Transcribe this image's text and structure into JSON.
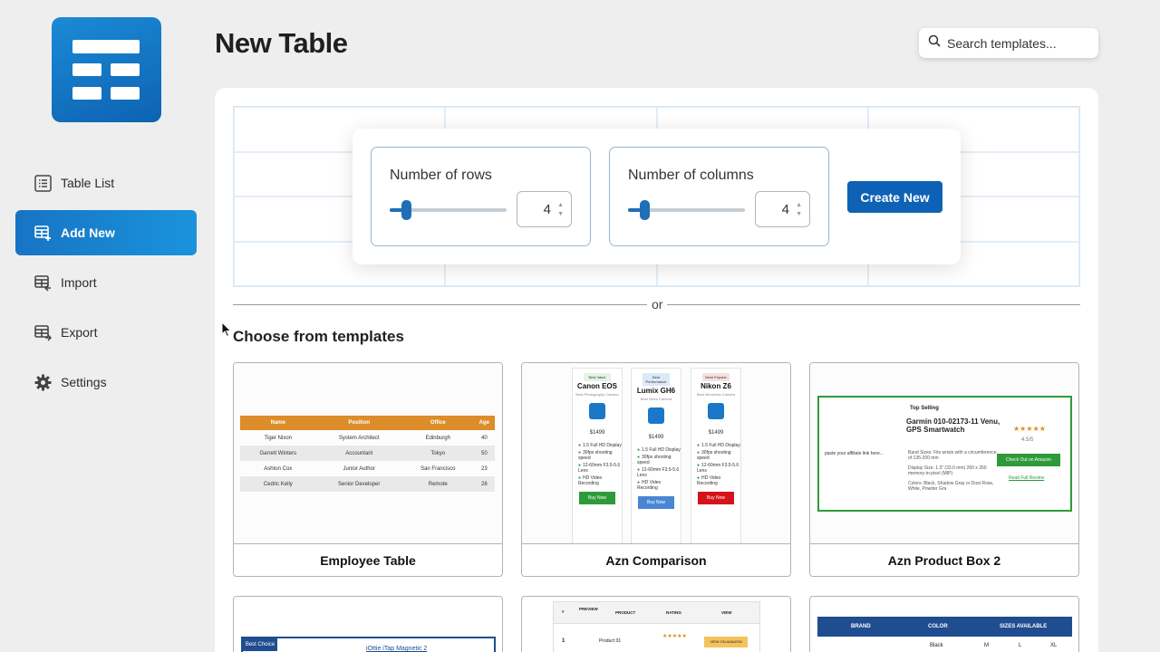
{
  "sidebar": {
    "items": [
      {
        "label": "Table List",
        "icon": "list-icon"
      },
      {
        "label": "Add New",
        "icon": "table-add-icon",
        "active": true
      },
      {
        "label": "Import",
        "icon": "table-import-icon"
      },
      {
        "label": "Export",
        "icon": "table-export-icon"
      },
      {
        "label": "Settings",
        "icon": "gear-icon"
      }
    ]
  },
  "header": {
    "title": "New Table"
  },
  "search": {
    "placeholder": "Search templates..."
  },
  "creator": {
    "rows_label": "Number of rows",
    "rows_value": "4",
    "cols_label": "Number of columns",
    "cols_value": "4",
    "create_label": "Create New"
  },
  "divider_text": "or",
  "templates_title": "Choose from templates",
  "templates": [
    {
      "name": "Employee Table",
      "preview": {
        "headers": [
          "Name",
          "Position",
          "Office",
          "Age"
        ],
        "rows": [
          [
            "Tiger Nixon",
            "System Architect",
            "Edinburgh",
            "40"
          ],
          [
            "Garrett Winters",
            "Accountant",
            "Tokyo",
            "50"
          ],
          [
            "Ashton Cox",
            "Junior Author",
            "San Francisco",
            "23"
          ],
          [
            "Cedric Kelly",
            "Senior Developer",
            "Remote",
            "28"
          ]
        ]
      }
    },
    {
      "name": "Azn Comparison",
      "preview": {
        "products": [
          {
            "badge": "Best Value",
            "name": "Canon EOS",
            "sub": "Best Photography Camera",
            "price": "$1499",
            "features": [
              "1.5 Full HD Display",
              "30fps shooting speed",
              "12-60mm F3.5-5.6 Lens",
              "HD Video Recording"
            ],
            "buy": "Buy Now",
            "buy_color": "#2f9a3a",
            "badge_bg": "#e4f3e4"
          },
          {
            "badge": "Best Performance",
            "name": "Lumix GH6",
            "sub": "Best Video Camera",
            "price": "$1499",
            "features": [
              "1.5 Full HD Display",
              "30fps shooting speed",
              "12-60mm F3.5-5.6 Lens",
              "HD Video Recording"
            ],
            "buy": "Buy Now",
            "buy_color": "#4a86d4",
            "badge_bg": "#dce9f7"
          },
          {
            "badge": "Most Popular",
            "name": "Nikon Z6",
            "sub": "Best Mirrorless Camera",
            "price": "$1499",
            "features": [
              "1.5 Full HD Display",
              "30fps shooting speed",
              "12-60mm F3.5-5.6 Lens",
              "HD Video Recording"
            ],
            "buy": "Buy Now",
            "buy_color": "#d4131b",
            "badge_bg": "#f7e0e0"
          }
        ]
      }
    },
    {
      "name": "Azn Product Box 2",
      "preview": {
        "tag": "Top Selling",
        "title": "Garmin 010-02173-11 Venu, GPS Smartwatch",
        "rating": "4.5/5",
        "left_text": "paste your affiliate link here...",
        "features": [
          "Band Sizes: Fits wrists with a circumference of 135-200 mm",
          "Display Size: 1.3\" (33.0 mm) 260 x 260 memory-in-pixel (MIP)",
          "Colors: Black, Shadow Gray or Dust Rose, White, Powder Gra"
        ],
        "cta": "Check Out on Amazon",
        "link": "Read Full Review"
      }
    },
    {
      "name": "",
      "preview": {
        "badge": "Best Choice",
        "title": "iOttie iTap Magnetic 2"
      }
    },
    {
      "name": "",
      "preview": {
        "headers": [
          "#",
          "PREVIEW",
          "PRODUCT",
          "RATING",
          "VIEW"
        ],
        "row": [
          "1",
          "",
          "Product 01",
          "★★★★★",
          "VIEW ON AMAZON"
        ]
      }
    },
    {
      "name": "",
      "preview": {
        "headers": [
          "BRAND",
          "COLOR",
          "SIZES AVAILABLE"
        ],
        "row": [
          "",
          "Black",
          "M",
          "L",
          "XL"
        ]
      }
    }
  ],
  "colors": {
    "accent": "#0e62b5",
    "orange": "#dc8c28",
    "green": "#2f9a3a",
    "navy": "#1f4d8f"
  }
}
